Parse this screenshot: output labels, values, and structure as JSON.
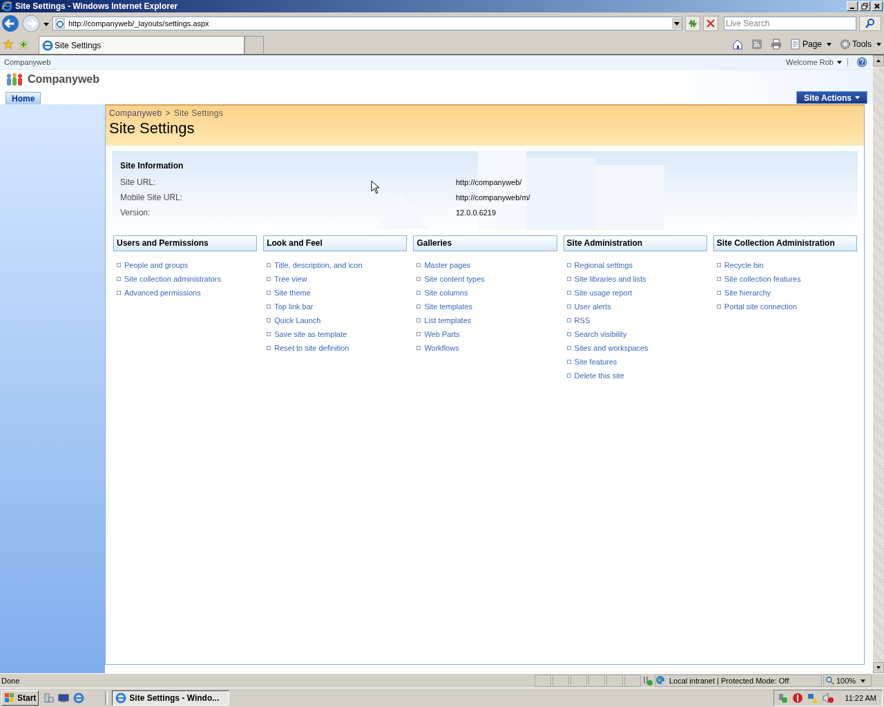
{
  "window": {
    "title": "Site Settings - Windows Internet Explorer"
  },
  "address_bar": {
    "url": "http://companyweb/_layouts/settings.aspx"
  },
  "search": {
    "placeholder": "Live Search"
  },
  "tabs": [
    {
      "label": "Site Settings",
      "selected": true
    }
  ],
  "command_bar": [
    "Page",
    "Tools"
  ],
  "site": {
    "breadcrumb_top": "Companyweb",
    "welcome": "Welcome Rob",
    "name": "Companyweb",
    "nav_tabs": [
      {
        "label": "Home",
        "selected": true
      }
    ],
    "site_actions": "Site Actions"
  },
  "page_title": {
    "breadcrumb": [
      {
        "label": "Companyweb",
        "link": true
      },
      {
        "label": ">",
        "link": false
      },
      {
        "label": "Site Settings",
        "link": false
      }
    ],
    "title": "Site Settings"
  },
  "site_information": {
    "heading": "Site Information",
    "rows": [
      {
        "label": "Site URL:",
        "value": "http://companyweb/"
      },
      {
        "label": "Mobile Site URL:",
        "value": "http://companyweb/m/"
      },
      {
        "label": "Version:",
        "value": "12.0.0.6219"
      }
    ]
  },
  "sections": [
    {
      "title": "Users and Permissions",
      "links": [
        "People and groups",
        "Site collection administrators",
        "Advanced permissions"
      ]
    },
    {
      "title": "Look and Feel",
      "links": [
        "Title, description, and icon",
        "Tree view",
        "Site theme",
        "Top link bar",
        "Quick Launch",
        "Save site as template",
        "Reset to site definition"
      ]
    },
    {
      "title": "Galleries",
      "links": [
        "Master pages",
        "Site content types",
        "Site columns",
        "Site templates",
        "List templates",
        "Web Parts",
        "Workflows"
      ]
    },
    {
      "title": "Site Administration",
      "links": [
        "Regional settings",
        "Site libraries and lists",
        "Site usage report",
        "User alerts",
        "RSS",
        "Search visibility",
        "Sites and workspaces",
        "Site features",
        "Delete this site"
      ]
    },
    {
      "title": "Site Collection Administration",
      "links": [
        "Recycle bin",
        "Site collection features",
        "Site hierarchy",
        "Portal site connection"
      ]
    }
  ],
  "status_bar": {
    "status": "Done",
    "zone": "Local intranet | Protected Mode: Off",
    "zoom": "100%"
  },
  "taskbar": {
    "start": "Start",
    "windows": [
      {
        "label": "Site Settings - Windo...",
        "selected": true
      }
    ],
    "clock": "11:22 AM"
  }
}
